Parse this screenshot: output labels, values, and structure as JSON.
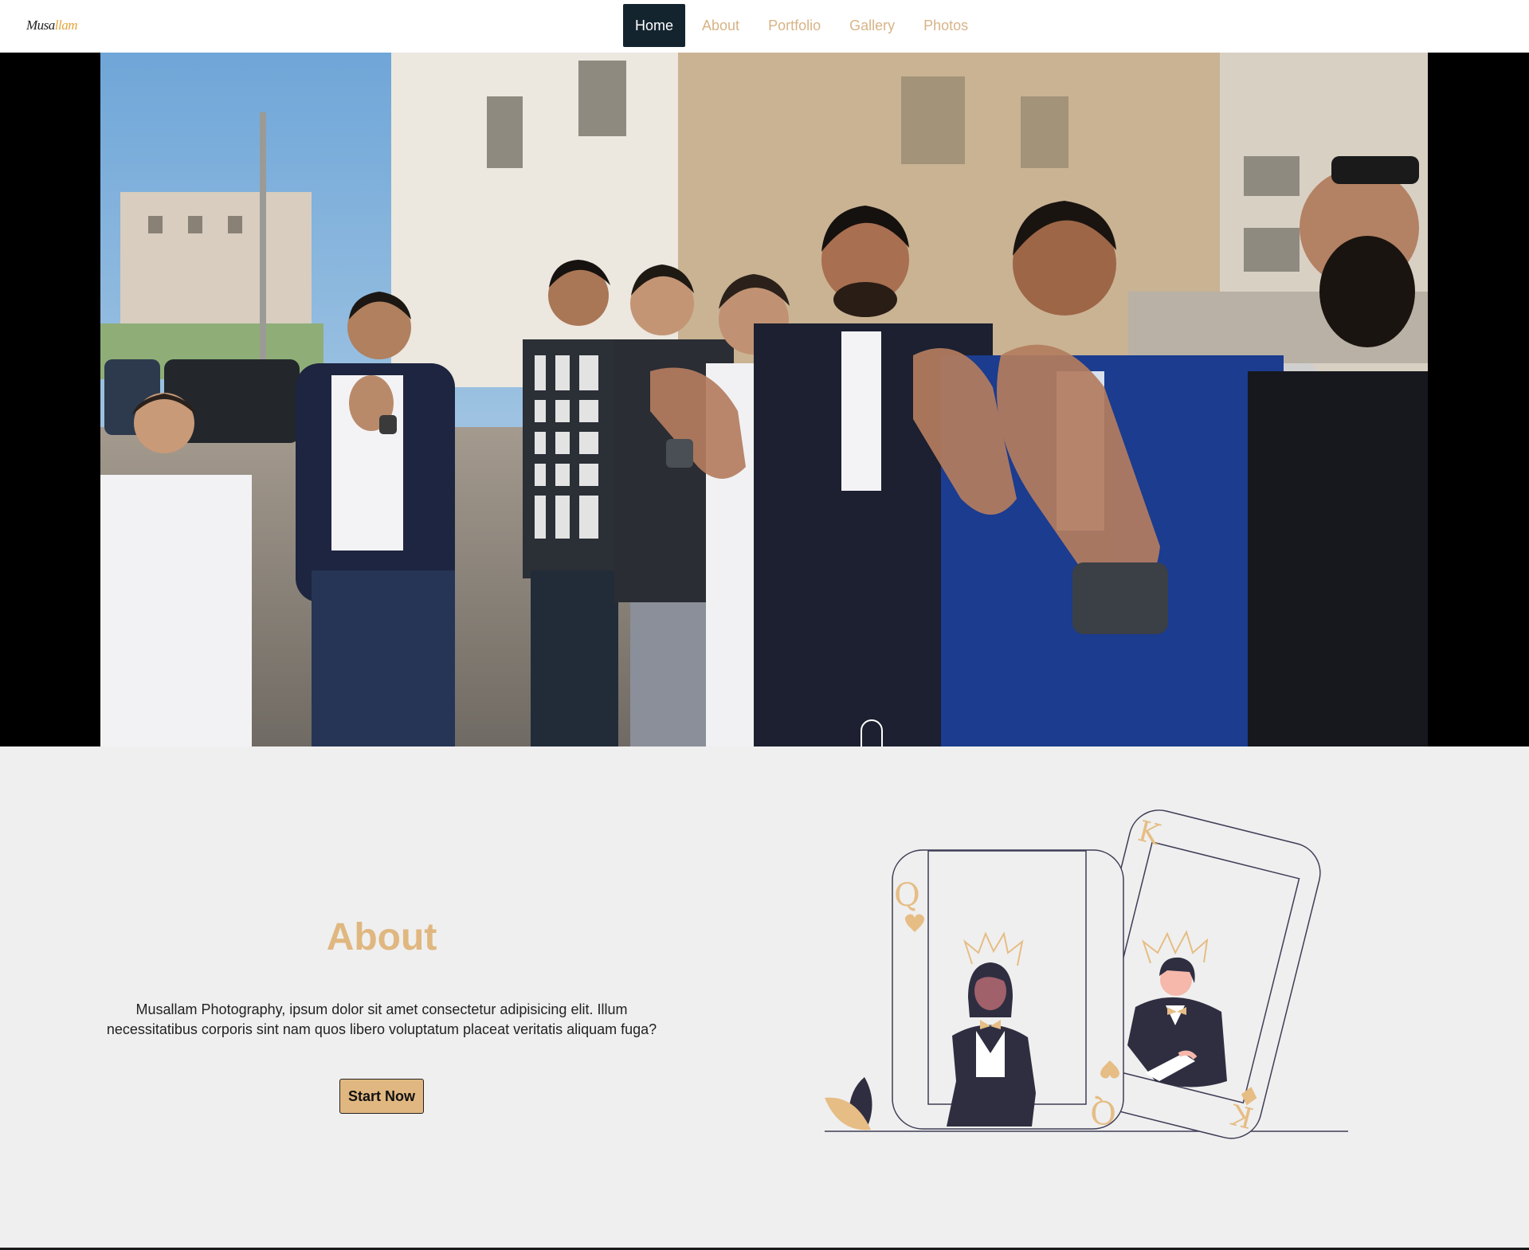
{
  "brand": {
    "logo_main": "Musa",
    "logo_accent": "llam"
  },
  "nav": {
    "items": [
      {
        "label": "Home",
        "active": true
      },
      {
        "label": "About",
        "active": false
      },
      {
        "label": "Portfolio",
        "active": false
      },
      {
        "label": "Gallery",
        "active": false
      },
      {
        "label": "Photos",
        "active": false
      }
    ]
  },
  "hero": {
    "scroll_icon": "mouse-scroll-icon"
  },
  "about": {
    "title": "About",
    "text": "Musallam Photography, ipsum dolor sit amet consectetur adipisicing elit. Illum necessitatibus corporis sint nam quos libero voluptatum placeat veritatis aliquam fuga?",
    "button_label": "Start Now",
    "card_left_rank": "Q",
    "card_right_rank": "K"
  },
  "colors": {
    "accent": "#e0b780",
    "nav_active_bg": "#14242f",
    "dark": "#2f2e41",
    "section_bg": "#efefef"
  }
}
